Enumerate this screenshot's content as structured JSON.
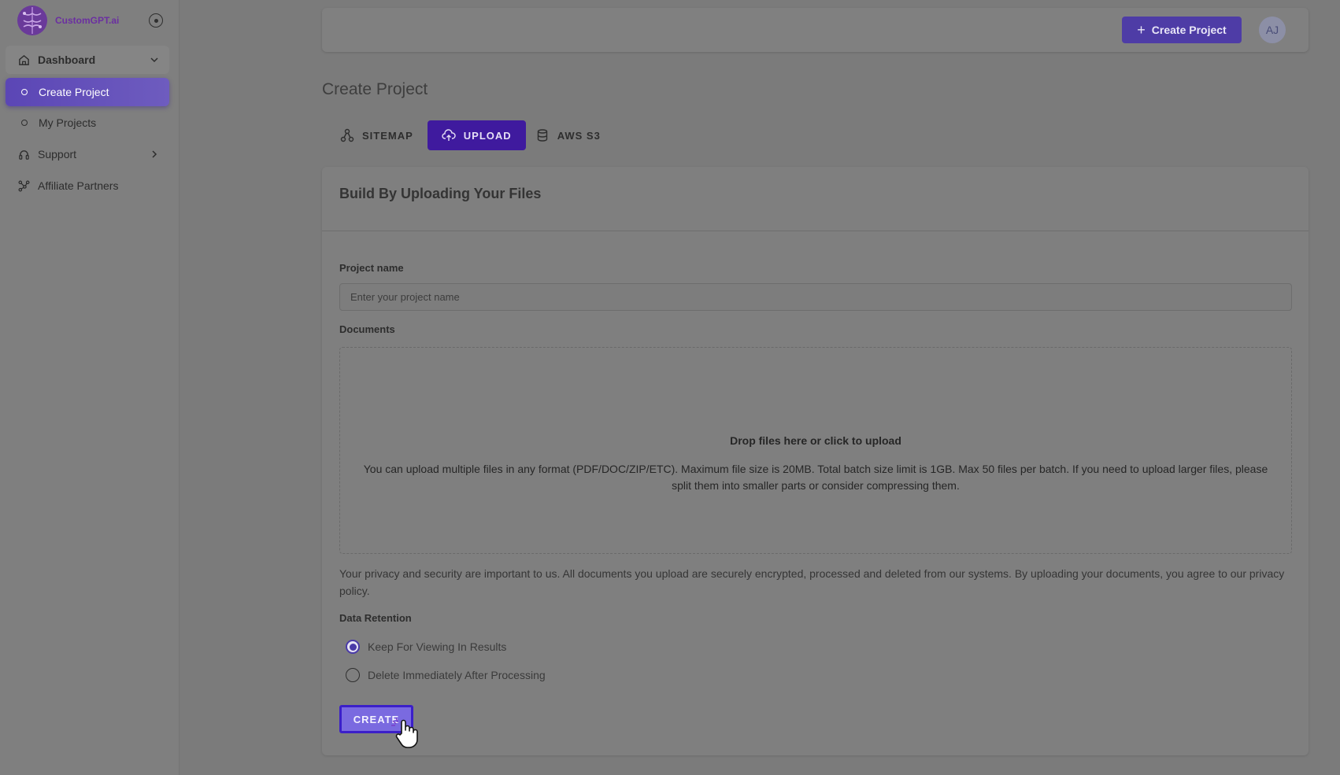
{
  "sidebar": {
    "brand": "CustomGPT.ai",
    "items": [
      {
        "label": "Dashboard"
      },
      {
        "label": "Create Project"
      },
      {
        "label": "My Projects"
      },
      {
        "label": "Support"
      },
      {
        "label": "Affiliate Partners"
      }
    ]
  },
  "header": {
    "create_button": "Create Project",
    "avatar_initials": "AJ"
  },
  "main": {
    "title": "Create Project",
    "tabs": [
      {
        "label": "SITEMAP"
      },
      {
        "label": "UPLOAD"
      },
      {
        "label": "AWS S3"
      }
    ],
    "card_title": "Build By Uploading Your Files",
    "project_name_label": "Project name",
    "project_name_placeholder": "Enter your project name",
    "documents_label": "Documents",
    "dropzone_title": "Drop files here or click to upload",
    "dropzone_desc": "You can upload multiple files in any format (PDF/DOC/ZIP/ETC). Maximum file size is 20MB. Total batch size limit is 1GB. Max 50 files per batch. If you need to upload larger files, please split them into smaller parts or consider compressing them.",
    "privacy_text": "Your privacy and security are important to us. All documents you upload are securely encrypted, processed and deleted from our systems. By uploading your documents, you agree to our privacy policy.",
    "data_retention_label": "Data Retention",
    "retention_options": [
      {
        "label": "Keep For Viewing In Results",
        "checked": true
      },
      {
        "label": "Delete Immediately After Processing",
        "checked": false
      }
    ],
    "create_button": "CREATE"
  },
  "colors": {
    "accent": "#4e3ca6",
    "active_tab": "#3f1a9e",
    "background_overlay": "#7b7b7b"
  }
}
